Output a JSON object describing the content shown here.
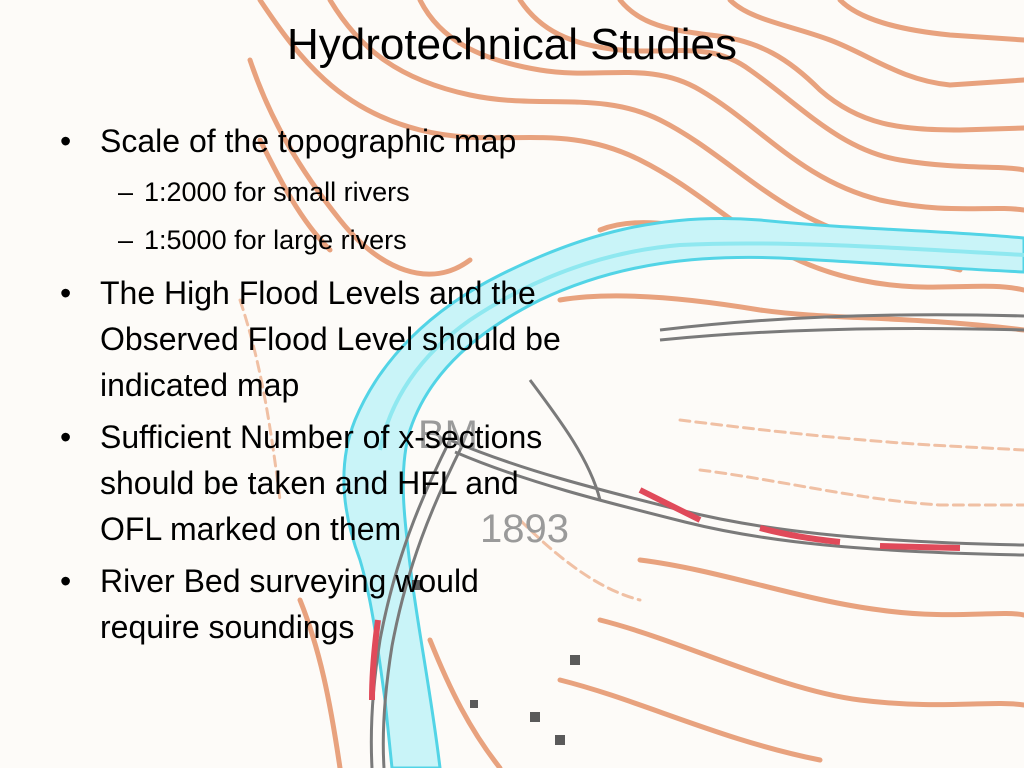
{
  "slide": {
    "title": "Hydrotechnical Studies",
    "bullet_marker": "•",
    "sub_marker": "–",
    "bullets": [
      {
        "lines": [
          "Scale of the topographic map"
        ],
        "sub": [
          "1:2000 for small rivers",
          "1:5000 for large rivers"
        ]
      },
      {
        "lines": [
          "The High Flood Levels and the",
          "Observed Flood Level should be",
          "indicated map"
        ]
      },
      {
        "lines": [
          "Sufficient Number of x-sections",
          "should be taken  and HFL and",
          "OFL marked on them"
        ]
      },
      {
        "lines": [
          "River Bed surveying would",
          "require soundings"
        ]
      }
    ]
  },
  "map": {
    "label_bm": "BM",
    "label_elevation": "1893",
    "colors": {
      "contour": "#e8a27e",
      "contour_light": "#f0c0a4",
      "river": "#8fe8f0",
      "river_edge": "#52d4e6",
      "road": "#7a7a7a",
      "road_red": "#e04a5a"
    }
  }
}
